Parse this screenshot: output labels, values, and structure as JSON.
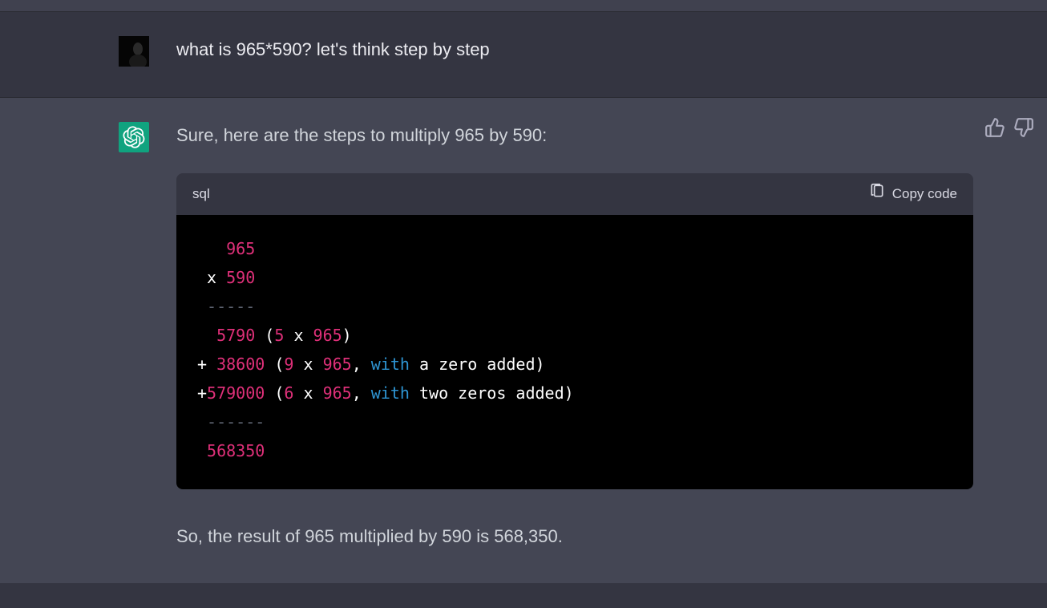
{
  "user": {
    "message": "what is 965*590? let's think step by step"
  },
  "assistant": {
    "intro": "Sure, here are the steps to multiply 965 by 590:",
    "followup": "So, the result of 965 multiplied by 590 is 568,350.",
    "codeblock": {
      "language": "sql",
      "copy_label": "Copy code",
      "tokens": {
        "t965": "965",
        "x": "x ",
        "t590": "590",
        "dashes5": "-----",
        "t5790": "5790",
        "lp": " (",
        "t5": "5",
        "mid_x": " x ",
        "rp": ")",
        "plus": "+ ",
        "t38600": "38600",
        "t9": "9",
        "comma": ", ",
        "with_kw": "with",
        "a_zero_added": " a zero added)",
        "plus_no_sp": "+",
        "t579000": "579000",
        "t6": "6",
        "two_zeros_added": " two zeros added)",
        "dashes6": "------",
        "t568350": "568350"
      }
    }
  },
  "feedback": {
    "like_label": "like",
    "dislike_label": "dislike"
  }
}
